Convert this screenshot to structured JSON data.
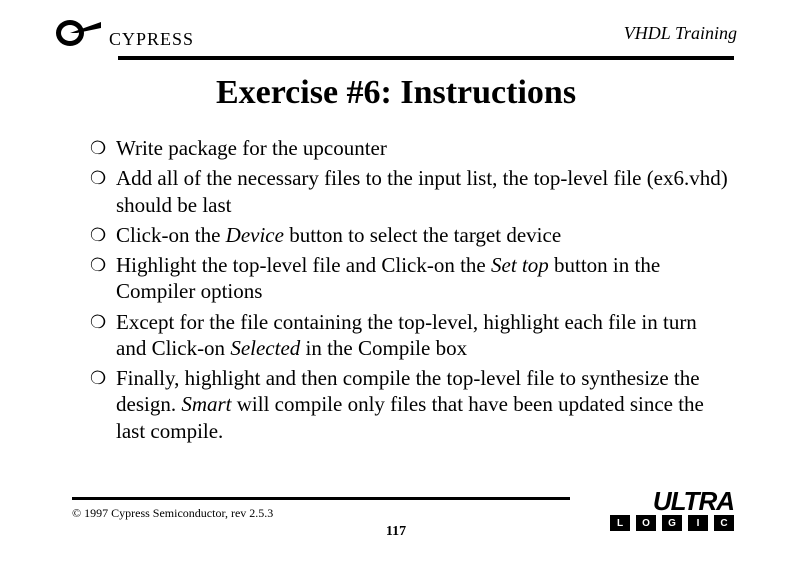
{
  "header": {
    "brand": "CYPRESS",
    "course": "VHDL Training"
  },
  "title": "Exercise #6: Instructions",
  "bullets": [
    {
      "parts": [
        {
          "t": "Write package for the upcounter"
        }
      ]
    },
    {
      "parts": [
        {
          "t": "Add all of the necessary files to the input list, the top-level file (ex6.vhd) should be last"
        }
      ]
    },
    {
      "parts": [
        {
          "t": "Click-on the "
        },
        {
          "t": "Device",
          "i": true
        },
        {
          "t": " button to select the target device"
        }
      ]
    },
    {
      "parts": [
        {
          "t": "Highlight the top-level file and Click-on the "
        },
        {
          "t": "Set top",
          "i": true
        },
        {
          "t": " button in the Compiler options"
        }
      ]
    },
    {
      "parts": [
        {
          "t": "Except for the file containing the top-level, highlight each file in turn and Click-on "
        },
        {
          "t": "Selected",
          "i": true
        },
        {
          "t": " in the Compile box"
        }
      ]
    },
    {
      "parts": [
        {
          "t": "Finally, highlight and then compile the top-level file to synthesize the design. "
        },
        {
          "t": "Smart",
          "i": true
        },
        {
          "t": " will compile only files that have been updated since the last compile."
        }
      ]
    }
  ],
  "footer": {
    "copyright": "© 1997 Cypress Semiconductor, rev 2.5.3",
    "page": "117",
    "ultra": {
      "word": "ULTRA",
      "letters": [
        "L",
        "O",
        "G",
        "I",
        "C"
      ]
    }
  }
}
